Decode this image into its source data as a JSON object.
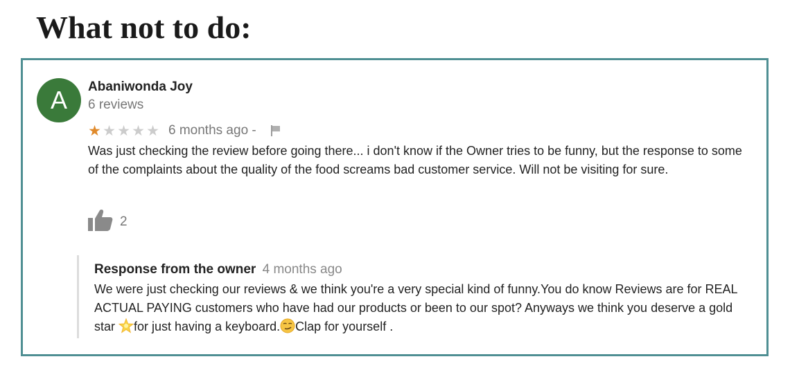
{
  "headline": "What not to do:",
  "review": {
    "avatar_letter": "A",
    "avatar_color": "#3a7a3a",
    "reviewer_name": "Abaniwonda Joy",
    "reviewer_reviews": "6 reviews",
    "rating": 1,
    "rating_max": 5,
    "star_filled_color": "#e08a2b",
    "star_empty_color": "#cccccc",
    "date": "6 months ago -",
    "flag_icon": "flag-icon",
    "text": "Was just checking the review before going there... i don't know if the Owner tries to be funny, but the response to some of the complaints about the quality of the food screams bad customer service. Will not be visiting for sure.",
    "like_icon": "thumbs-up-icon",
    "like_count": "2"
  },
  "response": {
    "title": "Response from the owner",
    "date": "4 months ago",
    "text_part1": "We were just checking our reviews & we think you're a very special kind of funny.You do know Reviews are for REAL ACTUAL PAYING customers who have had our products or been to our spot? Anyways we think you deserve a gold star ",
    "text_part2": "for just having a keyboard.",
    "text_part3": "Clap for yourself .",
    "star_emoji_icon": "glowing-star-emoji",
    "smirk_emoji_icon": "smirking-face-emoji"
  }
}
